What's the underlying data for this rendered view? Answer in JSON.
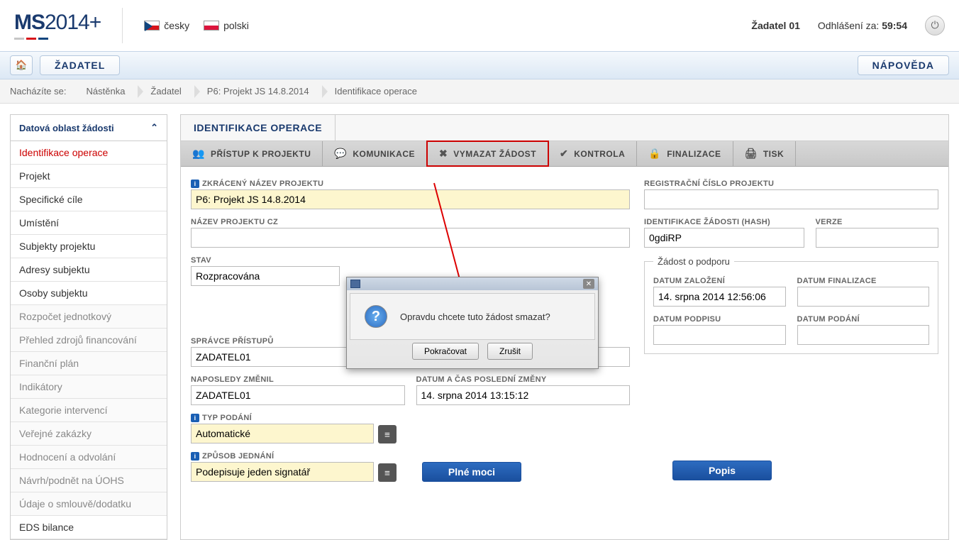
{
  "header": {
    "logo_a": "MS",
    "logo_b": "2014",
    "logo_c": "+",
    "lang1": "česky",
    "lang2": "polski",
    "user": "Žadatel 01",
    "logout_label": "Odhlášení za:",
    "logout_time": "59:54"
  },
  "nav": {
    "home": "⌂",
    "btn1": "ŽADATEL",
    "btn2": "NÁPOVĚDA"
  },
  "breadcrumb": {
    "label": "Nacházíte se:",
    "items": [
      "Nástěnka",
      "Žadatel",
      "P6: Projekt JS 14.8.2014",
      "Identifikace operace"
    ]
  },
  "sidebar": {
    "header": "Datová oblast žádosti",
    "items": [
      {
        "label": "Identifikace operace",
        "cls": "active"
      },
      {
        "label": "Projekt",
        "cls": ""
      },
      {
        "label": "Specifické cíle",
        "cls": ""
      },
      {
        "label": "Umístění",
        "cls": ""
      },
      {
        "label": "Subjekty projektu",
        "cls": ""
      },
      {
        "label": "Adresy subjektu",
        "cls": ""
      },
      {
        "label": "Osoby subjektu",
        "cls": ""
      },
      {
        "label": "Rozpočet jednotkový",
        "cls": "dim"
      },
      {
        "label": "Přehled zdrojů financování",
        "cls": "dim"
      },
      {
        "label": "Finanční plán",
        "cls": "dim"
      },
      {
        "label": "Indikátory",
        "cls": "dim"
      },
      {
        "label": "Kategorie intervencí",
        "cls": "dim"
      },
      {
        "label": "Veřejné zakázky",
        "cls": "dim"
      },
      {
        "label": "Hodnocení a odvolání",
        "cls": "dim"
      },
      {
        "label": "Návrh/podnět na ÚOHS",
        "cls": "dim"
      },
      {
        "label": "Údaje o smlouvě/dodatku",
        "cls": "dim"
      },
      {
        "label": "EDS bilance",
        "cls": ""
      }
    ]
  },
  "main_title": "IDENTIFIKACE OPERACE",
  "toolbar": [
    {
      "icon": "👥",
      "label": "PŘÍSTUP K PROJEKTU",
      "hl": false
    },
    {
      "icon": "💬",
      "label": "KOMUNIKACE",
      "hl": false
    },
    {
      "icon": "✖",
      "label": "VYMAZAT ŽÁDOST",
      "hl": true
    },
    {
      "icon": "✔",
      "label": "KONTROLA",
      "hl": false
    },
    {
      "icon": "🔒",
      "label": "FINALIZACE",
      "hl": false
    },
    {
      "icon": "🖨",
      "label": "TISK",
      "hl": false
    }
  ],
  "form": {
    "short_name_label": "ZKRÁCENÝ NÁZEV PROJEKTU",
    "short_name": "P6: Projekt JS 14.8.2014",
    "name_cz_label": "NÁZEV PROJEKTU CZ",
    "name_cz": "",
    "state_label": "STAV",
    "state": "Rozpracována",
    "admin_label": "SPRÁVCE PŘÍSTUPŮ",
    "admin": "ZADATEL01",
    "lastmod_by_label": "NAPOSLEDY ZMĚNIL",
    "lastmod_by": "ZADATEL01",
    "lastmod_at_label": "DATUM A ČAS POSLEDNÍ ZMĚNY",
    "lastmod_at": "14. srpna 2014 13:15:12",
    "submit_type_label": "TYP PODÁNÍ",
    "submit_type": "Automatické",
    "sign_mode_label": "ZPŮSOB JEDNÁNÍ",
    "sign_mode": "Podepisuje jeden signatář",
    "btn_plne_moci": "Plné moci",
    "reg_no_label": "REGISTRAČNÍ ČÍSLO PROJEKTU",
    "reg_no": "",
    "hash_label": "IDENTIFIKACE ŽÁDOSTI (HASH)",
    "hash": "0gdiRP",
    "version_label": "VERZE",
    "version": "",
    "fieldset_legend": "Žádost o podporu",
    "created_label": "DATUM ZALOŽENÍ",
    "created": "14. srpna 2014 12:56:06",
    "finalized_label": "DATUM FINALIZACE",
    "finalized": "",
    "signed_label": "DATUM PODPISU",
    "signed": "",
    "submitted_label": "DATUM PODÁNÍ",
    "submitted": "",
    "btn_popis": "Popis"
  },
  "dialog": {
    "msg": "Opravdu chcete tuto žádost smazat?",
    "ok": "Pokračovat",
    "cancel": "Zrušit"
  }
}
